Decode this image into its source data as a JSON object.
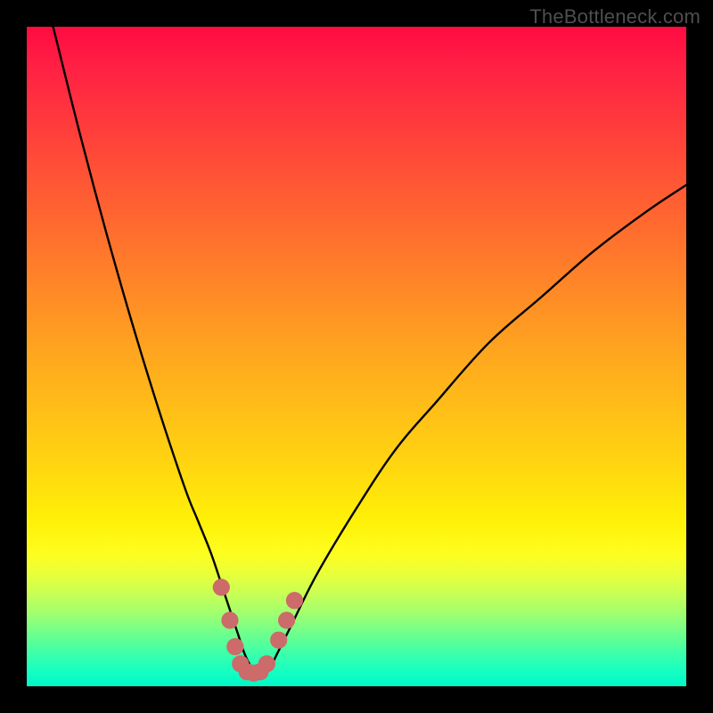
{
  "watermark": "TheBottleneck.com",
  "chart_data": {
    "type": "line",
    "title": "",
    "xlabel": "",
    "ylabel": "",
    "xlim": [
      0,
      100
    ],
    "ylim": [
      0,
      100
    ],
    "grid": false,
    "legend": false,
    "series": [
      {
        "name": "bottleneck-curve",
        "color": "#000000",
        "x": [
          4,
          8,
          12,
          16,
          20,
          24,
          26,
          28,
          30,
          31,
          32,
          33,
          34,
          35,
          36,
          37,
          38,
          40,
          44,
          50,
          56,
          62,
          70,
          78,
          86,
          94,
          100
        ],
        "y": [
          100,
          84,
          69,
          55,
          42,
          30,
          25,
          20,
          14,
          11,
          8,
          5,
          3,
          2,
          2,
          3,
          5,
          9,
          17,
          27,
          36,
          43,
          52,
          59,
          66,
          72,
          76
        ]
      }
    ],
    "markers": {
      "name": "highlight-dots",
      "color": "#cd6a6a",
      "radius_pct": 1.3,
      "points": [
        {
          "x": 29.5,
          "y": 15
        },
        {
          "x": 30.8,
          "y": 10
        },
        {
          "x": 31.6,
          "y": 6
        },
        {
          "x": 32.4,
          "y": 3.4
        },
        {
          "x": 33.4,
          "y": 2.2
        },
        {
          "x": 34.4,
          "y": 2.0
        },
        {
          "x": 35.4,
          "y": 2.2
        },
        {
          "x": 36.4,
          "y": 3.4
        },
        {
          "x": 38.2,
          "y": 7
        },
        {
          "x": 39.4,
          "y": 10
        },
        {
          "x": 40.6,
          "y": 13
        }
      ]
    },
    "gradient_stops": [
      {
        "pos": 0.0,
        "color": "#ff0b41"
      },
      {
        "pos": 0.3,
        "color": "#ff6a2f"
      },
      {
        "pos": 0.55,
        "color": "#ffb31b"
      },
      {
        "pos": 0.75,
        "color": "#fff107"
      },
      {
        "pos": 0.88,
        "color": "#a0ff70"
      },
      {
        "pos": 1.0,
        "color": "#00f7c6"
      }
    ]
  }
}
